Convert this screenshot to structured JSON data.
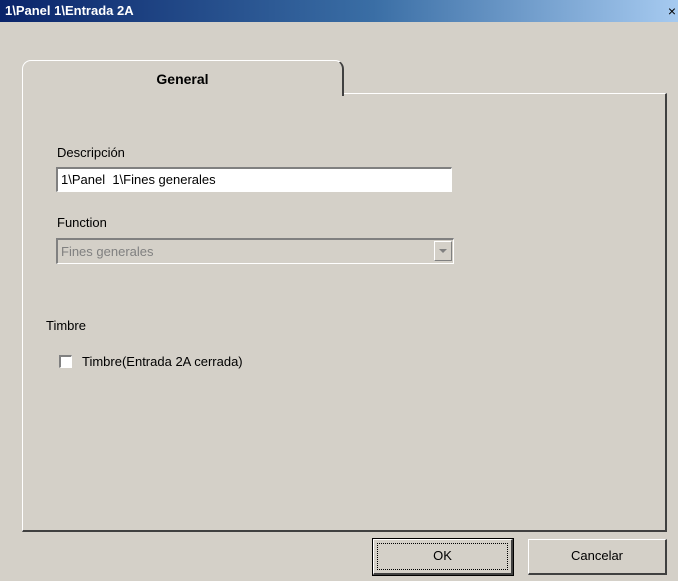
{
  "window": {
    "title": "1\\Panel  1\\Entrada 2A",
    "close_glyph": "×"
  },
  "tabs": [
    {
      "label": "General",
      "active": true
    }
  ],
  "general": {
    "descripcion_label": "Descripción",
    "descripcion_value": "1\\Panel  1\\Fines generales",
    "function_label": "Function",
    "function_value": "Fines generales",
    "function_disabled": true
  },
  "timbre": {
    "group_label": "Timbre",
    "checkbox_label": "Timbre(Entrada 2A cerrada)",
    "checked": false
  },
  "buttons": {
    "ok_label": "OK",
    "cancel_label": "Cancelar"
  },
  "icons": {
    "combo_arrow": "chevron-down-icon",
    "close": "close-icon"
  },
  "colors": {
    "title_gradient_start": "#0a246a",
    "title_gradient_end": "#a6caf0",
    "window_bg": "#d4d0c8",
    "disabled_text": "#808080"
  }
}
